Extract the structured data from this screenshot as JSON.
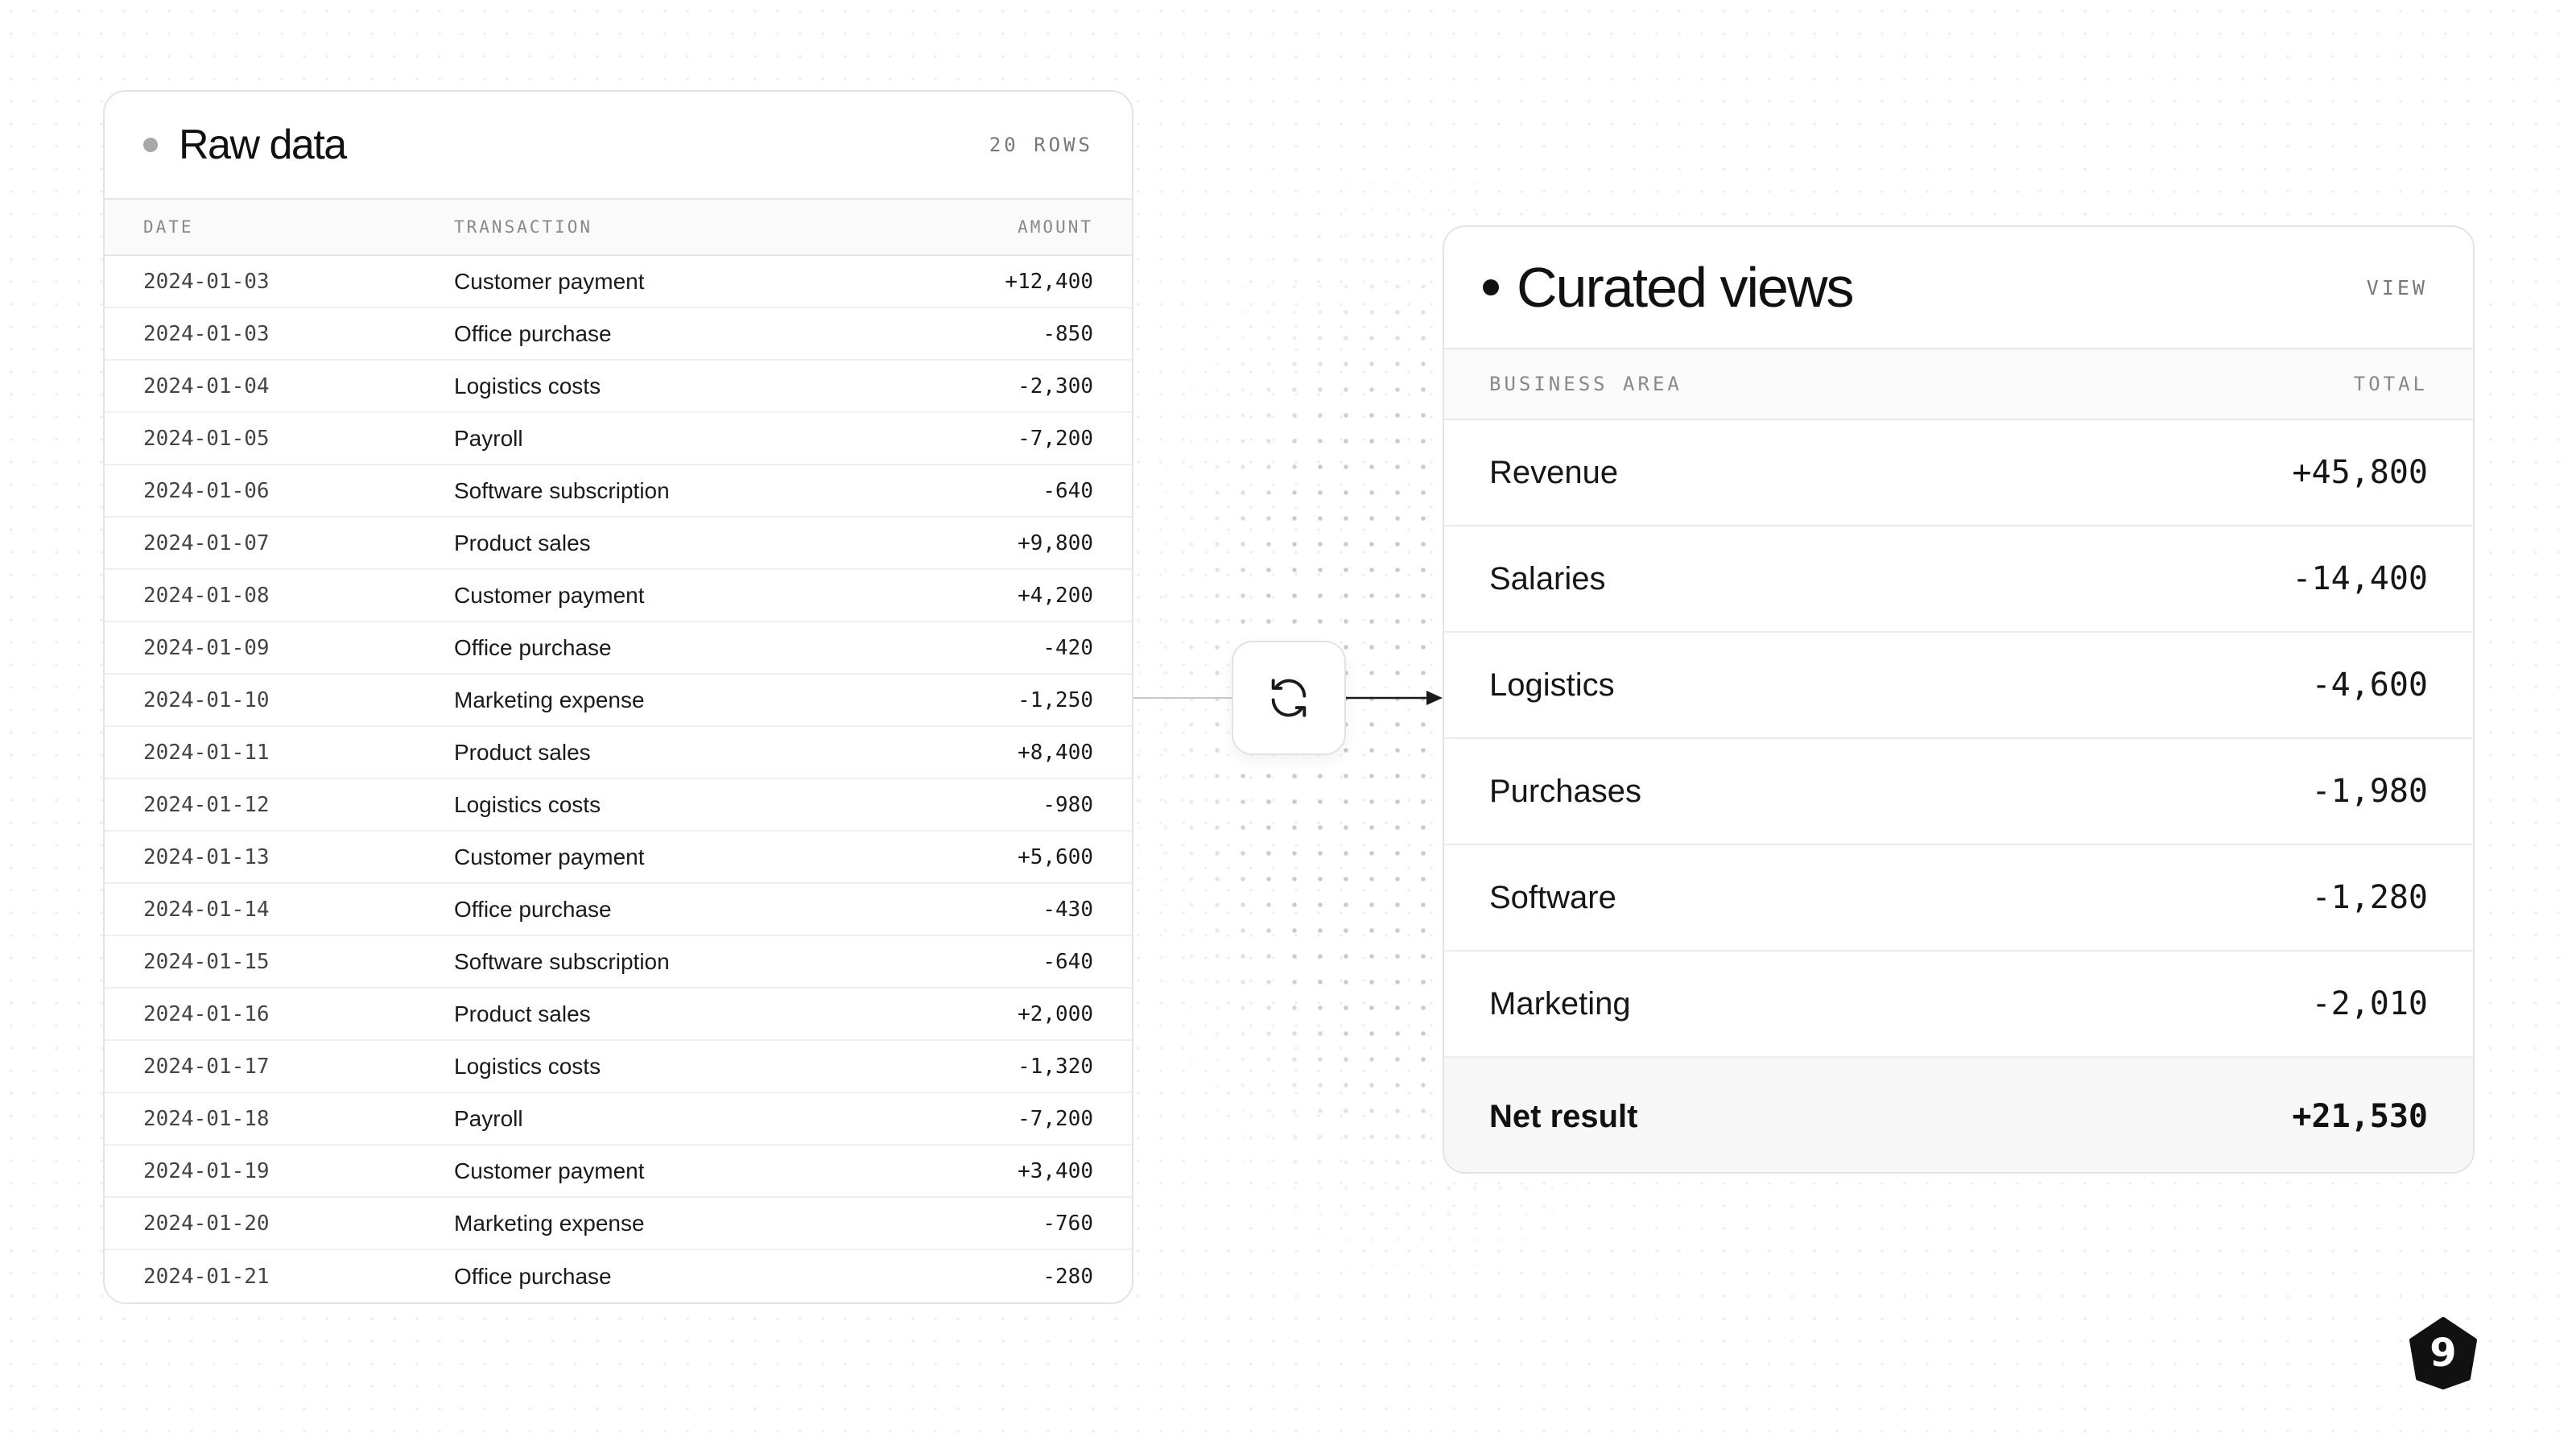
{
  "raw_panel": {
    "title": "Raw data",
    "row_count": "20 ROWS",
    "columns": {
      "date": "DATE",
      "transaction": "TRANSACTION",
      "amount": "AMOUNT"
    },
    "rows": [
      {
        "date": "2024-01-03",
        "transaction": "Customer payment",
        "amount": "+12,400"
      },
      {
        "date": "2024-01-03",
        "transaction": "Office purchase",
        "amount": "-850"
      },
      {
        "date": "2024-01-04",
        "transaction": "Logistics costs",
        "amount": "-2,300"
      },
      {
        "date": "2024-01-05",
        "transaction": "Payroll",
        "amount": "-7,200"
      },
      {
        "date": "2024-01-06",
        "transaction": "Software subscription",
        "amount": "-640"
      },
      {
        "date": "2024-01-07",
        "transaction": "Product sales",
        "amount": "+9,800"
      },
      {
        "date": "2024-01-08",
        "transaction": "Customer payment",
        "amount": "+4,200"
      },
      {
        "date": "2024-01-09",
        "transaction": "Office purchase",
        "amount": "-420"
      },
      {
        "date": "2024-01-10",
        "transaction": "Marketing expense",
        "amount": "-1,250"
      },
      {
        "date": "2024-01-11",
        "transaction": "Product sales",
        "amount": "+8,400"
      },
      {
        "date": "2024-01-12",
        "transaction": "Logistics costs",
        "amount": "-980"
      },
      {
        "date": "2024-01-13",
        "transaction": "Customer payment",
        "amount": "+5,600"
      },
      {
        "date": "2024-01-14",
        "transaction": "Office purchase",
        "amount": "-430"
      },
      {
        "date": "2024-01-15",
        "transaction": "Software subscription",
        "amount": "-640"
      },
      {
        "date": "2024-01-16",
        "transaction": "Product sales",
        "amount": "+2,000"
      },
      {
        "date": "2024-01-17",
        "transaction": "Logistics costs",
        "amount": "-1,320"
      },
      {
        "date": "2024-01-18",
        "transaction": "Payroll",
        "amount": "-7,200"
      },
      {
        "date": "2024-01-19",
        "transaction": "Customer payment",
        "amount": "+3,400"
      },
      {
        "date": "2024-01-20",
        "transaction": "Marketing expense",
        "amount": "-760"
      },
      {
        "date": "2024-01-21",
        "transaction": "Office purchase",
        "amount": "-280"
      }
    ]
  },
  "connector": {
    "icon": "refresh-icon"
  },
  "curated_panel": {
    "title": "Curated views",
    "badge": "VIEW",
    "columns": {
      "area": "BUSINESS AREA",
      "total": "TOTAL"
    },
    "rows": [
      {
        "area": "Revenue",
        "total": "+45,800"
      },
      {
        "area": "Salaries",
        "total": "-14,400"
      },
      {
        "area": "Logistics",
        "total": "-4,600"
      },
      {
        "area": "Purchases",
        "total": "-1,980"
      },
      {
        "area": "Software",
        "total": "-1,280"
      },
      {
        "area": "Marketing",
        "total": "-2,010"
      }
    ],
    "net": {
      "label": "Net result",
      "total": "+21,530"
    }
  },
  "logo": {
    "icon": "brand-logo-icon",
    "glyph": "9"
  },
  "colors": {
    "text": "#111111",
    "muted": "#888888",
    "border": "#e3e3e3",
    "dot": "#c9c9c9"
  }
}
